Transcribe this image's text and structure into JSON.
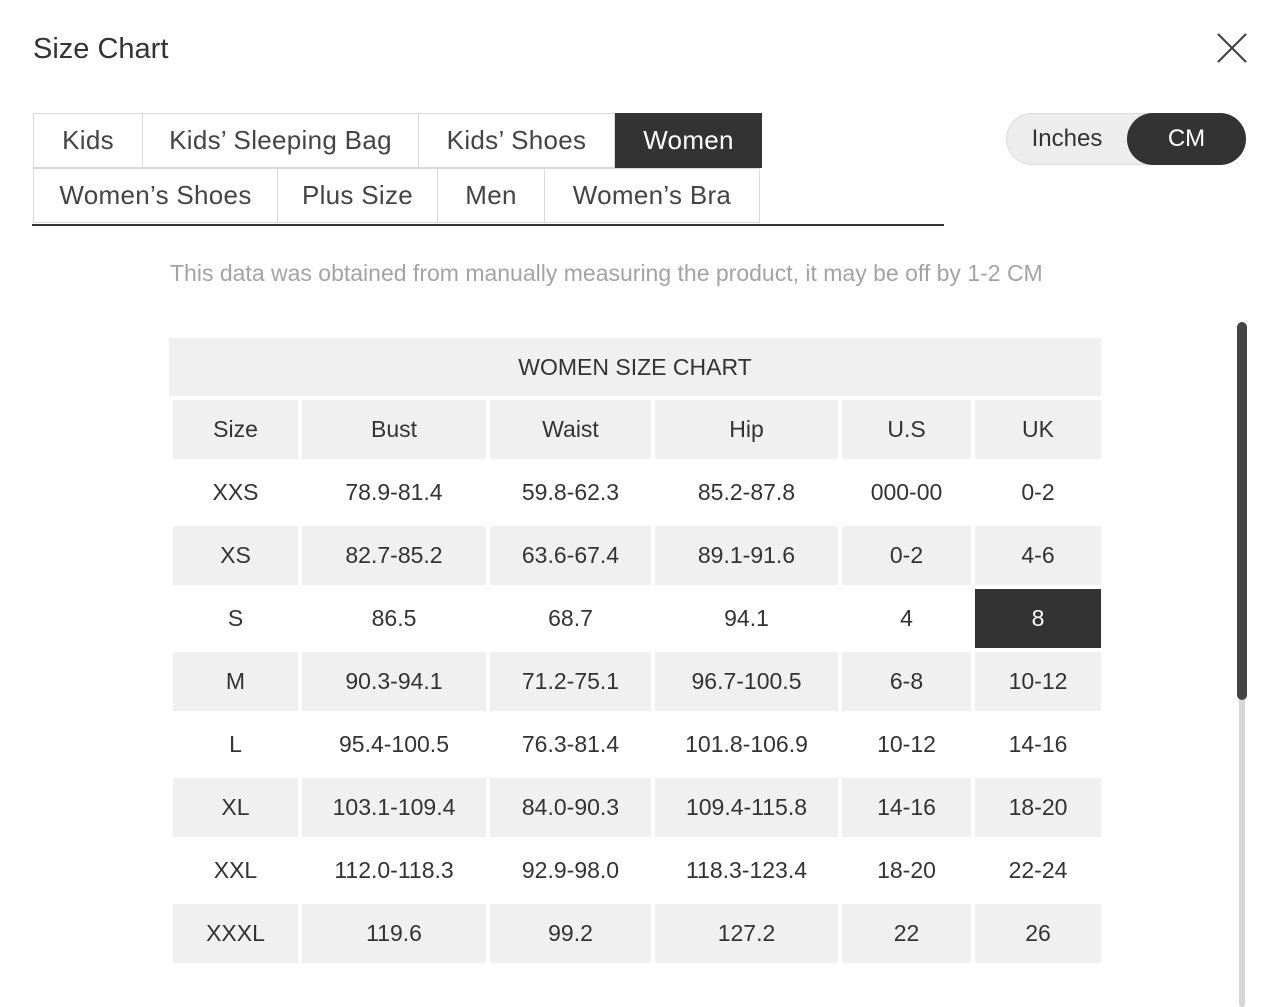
{
  "dialog": {
    "title": "Size Chart"
  },
  "tabs": [
    {
      "label": "Kids",
      "active": false
    },
    {
      "label": "Kids’ Sleeping Bag",
      "active": false
    },
    {
      "label": "Kids’ Shoes",
      "active": false
    },
    {
      "label": "Women",
      "active": true
    },
    {
      "label": "Women’s Shoes",
      "active": false
    },
    {
      "label": "Plus Size",
      "active": false
    },
    {
      "label": "Men",
      "active": false
    },
    {
      "label": "Women’s Bra",
      "active": false
    }
  ],
  "units": {
    "inches": "Inches",
    "cm": "CM",
    "selected": "CM"
  },
  "note": "This data was obtained from manually measuring the product, it may be off by 1-2 CM",
  "size_chart": {
    "title": "WOMEN SIZE CHART",
    "columns": [
      "Size",
      "Bust",
      "Waist",
      "Hip",
      "U.S",
      "UK"
    ],
    "rows": [
      [
        "XXS",
        "78.9-81.4",
        "59.8-62.3",
        "85.2-87.8",
        "000-00",
        "0-2"
      ],
      [
        "XS",
        "82.7-85.2",
        "63.6-67.4",
        "89.1-91.6",
        "0-2",
        "4-6"
      ],
      [
        "S",
        "86.5",
        "68.7",
        "94.1",
        "4",
        "8"
      ],
      [
        "M",
        "90.3-94.1",
        "71.2-75.1",
        "96.7-100.5",
        "6-8",
        "10-12"
      ],
      [
        "L",
        "95.4-100.5",
        "76.3-81.4",
        "101.8-106.9",
        "10-12",
        "14-16"
      ],
      [
        "XL",
        "103.1-109.4",
        "84.0-90.3",
        "109.4-115.8",
        "14-16",
        "18-20"
      ],
      [
        "XXL",
        "112.0-118.3",
        "92.9-98.0",
        "118.3-123.4",
        "18-20",
        "22-24"
      ],
      [
        "XXXL",
        "119.6",
        "99.2",
        "127.2",
        "22",
        "26"
      ]
    ],
    "highlighted_cell": {
      "row": 2,
      "col": 5
    }
  },
  "colors": {
    "accent": "#333333",
    "shade": "#f0f0f0",
    "note": "#a3a3a3"
  }
}
